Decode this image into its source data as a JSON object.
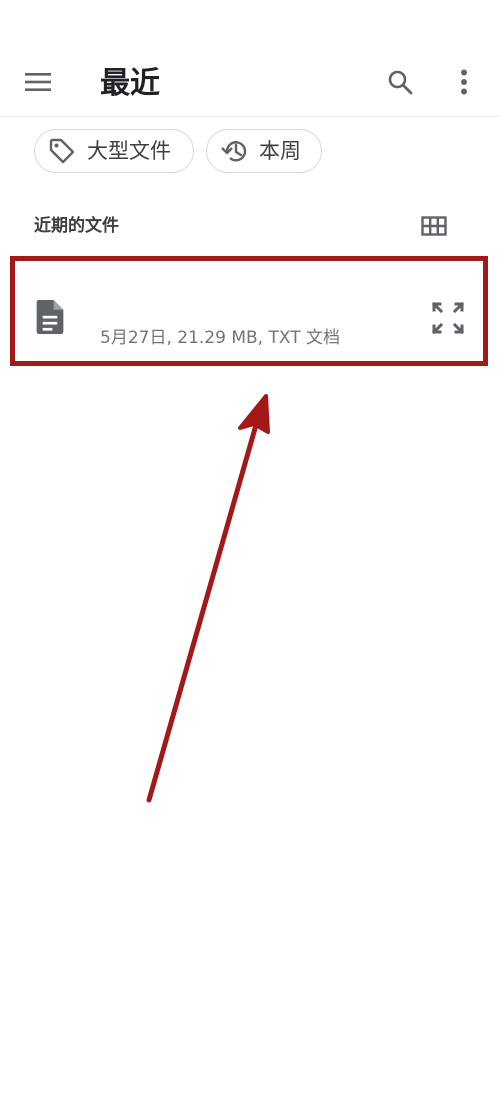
{
  "header": {
    "title": "最近"
  },
  "filters": {
    "large_files": "大型文件",
    "this_week": "本周"
  },
  "section": {
    "title": "近期的文件"
  },
  "file": {
    "meta": "5月27日, 21.29 MB, TXT 文档"
  },
  "icons": {
    "menu": "menu-icon",
    "search": "search-icon",
    "more": "more-vert-icon",
    "tag": "tag-icon",
    "history": "history-icon",
    "grid": "grid-view-icon",
    "document": "document-icon",
    "expand": "expand-icon"
  },
  "colors": {
    "annotation": "#a31818",
    "icon_gray": "#5f6368"
  }
}
